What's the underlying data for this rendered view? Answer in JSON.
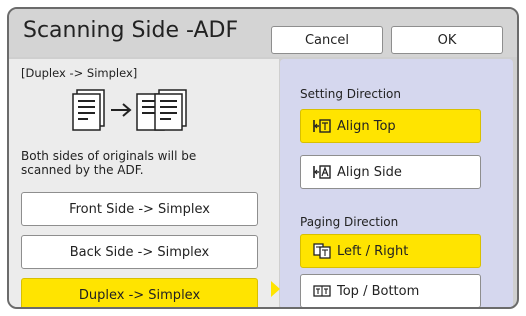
{
  "header": {
    "title": "Scanning Side -ADF",
    "cancel_label": "Cancel",
    "ok_label": "OK"
  },
  "left_panel": {
    "mode_label": "[Duplex -> Simplex]",
    "description": "Both sides of originals will be scanned by the ADF.",
    "options": [
      {
        "label": "Front Side -> Simplex",
        "selected": false
      },
      {
        "label": "Back Side -> Simplex",
        "selected": false
      },
      {
        "label": "Duplex -> Simplex",
        "selected": true
      }
    ]
  },
  "right_panel": {
    "setting_direction_label": "Setting Direction",
    "setting_direction_options": [
      {
        "label": "Align Top",
        "icon": "align-top-icon",
        "selected": true
      },
      {
        "label": "Align Side",
        "icon": "align-side-icon",
        "selected": false
      }
    ],
    "paging_direction_label": "Paging Direction",
    "paging_direction_options": [
      {
        "label": "Left / Right",
        "icon": "left-right-paging-icon",
        "selected": true
      },
      {
        "label": "Top / Bottom",
        "icon": "top-bottom-paging-icon",
        "selected": false
      }
    ]
  },
  "colors": {
    "selected": "#ffe400",
    "right_panel": "#d5d7ee",
    "left_panel": "#ececec",
    "frame": "#cfcfcf"
  }
}
